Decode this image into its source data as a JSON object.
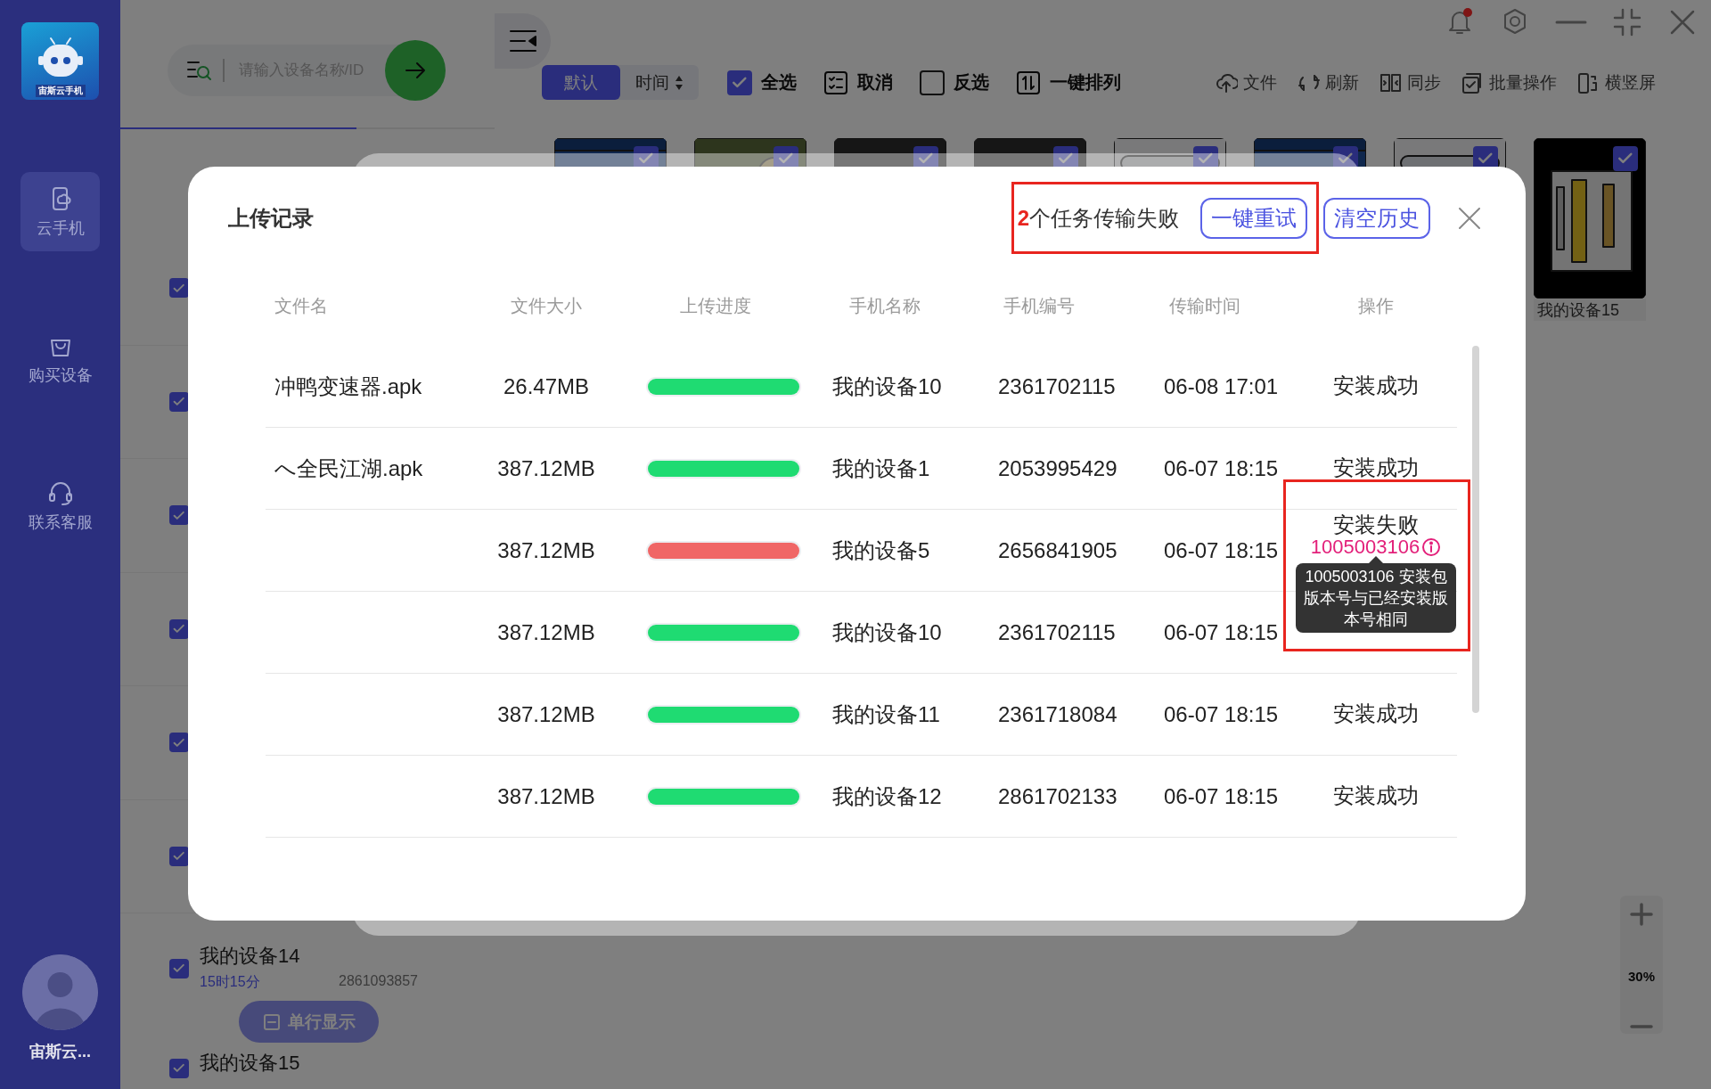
{
  "app": {
    "logo_text": "宙斯云手机",
    "user": "宙斯云...",
    "nav": [
      {
        "label": "云手机",
        "selected": true
      },
      {
        "label": "购买设备",
        "selected": false
      },
      {
        "label": "联系客服",
        "selected": false
      }
    ]
  },
  "search": {
    "placeholder": "请输入设备名称/ID"
  },
  "devices": [
    {
      "checked": true
    },
    {
      "checked": true
    },
    {
      "checked": true
    },
    {
      "checked": true
    },
    {
      "checked": true
    },
    {
      "checked": true
    },
    {
      "name": "我的设备14",
      "time": "15时15分",
      "number": "2861093857",
      "checked": true
    },
    {
      "name": "我的设备15",
      "checked": true
    }
  ],
  "single_row_button": "单行显示",
  "notifications": {
    "unread": true
  },
  "sort_tabs": [
    {
      "label": "默认",
      "selected": true
    },
    {
      "label": "时间",
      "selected": false
    }
  ],
  "selection_tools": [
    {
      "kind": "checkbox",
      "label": "全选",
      "checked": true
    },
    {
      "kind": "cancel",
      "label": "取消"
    },
    {
      "kind": "checkbox",
      "label": "反选",
      "checked": false
    },
    {
      "kind": "arrange",
      "label": "一键排列"
    }
  ],
  "actions": [
    "文件",
    "刷新",
    "同步",
    "批量操作",
    "横竖屏"
  ],
  "thumbnails": [
    {
      "checked": true
    },
    {
      "checked": true
    },
    {
      "checked": true
    },
    {
      "checked": true
    },
    {
      "checked": true
    },
    {
      "checked": true
    },
    {
      "checked": true
    },
    {
      "label": "我的设备15",
      "checked": true
    }
  ],
  "zoom": {
    "reading": "30%"
  },
  "dialog": {
    "title": "上传记录",
    "failed_count": "2",
    "failure_text": "个任务传输失败",
    "retry_button": "一键重试",
    "clear_button": "清空历史",
    "columns": [
      "文件名",
      "文件大小",
      "上传进度",
      "手机名称",
      "手机编号",
      "传输时间",
      "操作"
    ],
    "rows": [
      {
        "file_name": "冲鸭变速器.apk",
        "size": "26.47MB",
        "level": 1,
        "failed": false,
        "phone_name": "我的设备10",
        "phone_number": "2361702115",
        "time": "06-08 17:01",
        "result": "安装成功"
      },
      {
        "file_name": "へ全民江湖.apk",
        "size": "387.12MB",
        "level": 1,
        "failed": false,
        "phone_name": "我的设备1",
        "phone_number": "2053995429",
        "time": "06-07 18:15",
        "result": "安装成功"
      },
      {
        "size": "387.12MB",
        "level": 1,
        "failed": true,
        "phone_name": "我的设备5",
        "phone_number": "2656841905",
        "time": "06-07 18:15",
        "result": "安装失败",
        "error_code": "1005003106",
        "tooltip": "1005003106 安装包版本号与已经安装版本号相同"
      },
      {
        "size": "387.12MB",
        "level": 1,
        "failed": false,
        "phone_name": "我的设备10",
        "phone_number": "2361702115",
        "time": "06-07 18:15"
      },
      {
        "size": "387.12MB",
        "level": 1,
        "failed": false,
        "phone_name": "我的设备11",
        "phone_number": "2361718084",
        "time": "06-07 18:15",
        "result": "安装成功"
      },
      {
        "size": "387.12MB",
        "level": 1,
        "failed": false,
        "phone_name": "我的设备12",
        "phone_number": "2861702133",
        "time": "06-07 18:15",
        "result": "安装成功"
      }
    ]
  }
}
